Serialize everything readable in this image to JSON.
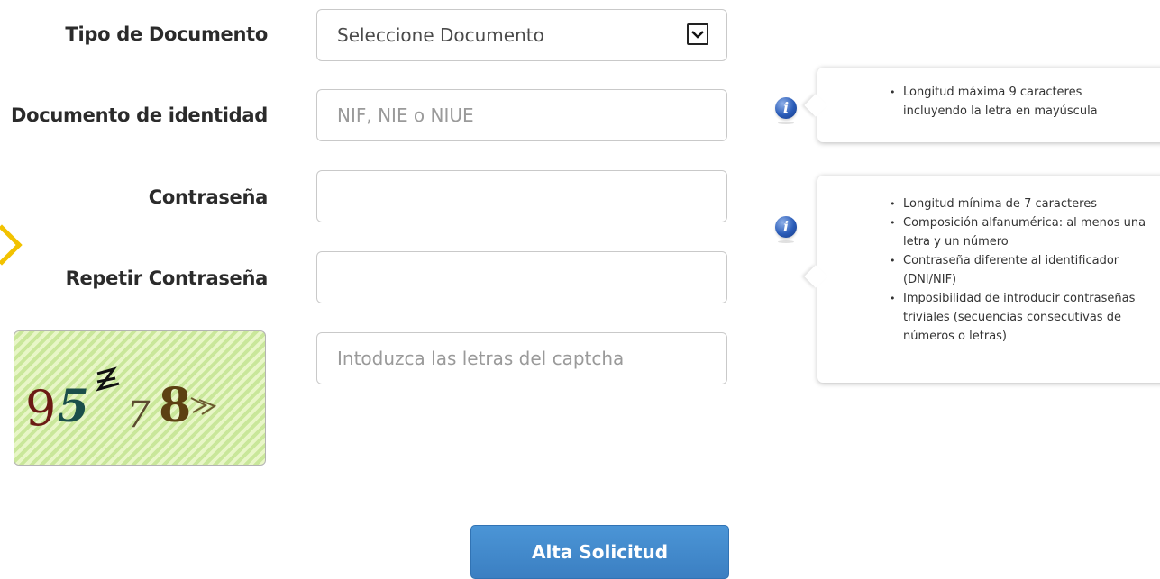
{
  "form": {
    "tipo_documento": {
      "label": "Tipo de Documento",
      "selected": "Seleccione Documento"
    },
    "documento_identidad": {
      "label": "Documento de identidad",
      "placeholder": "NIF, NIE o NIUE",
      "value": ""
    },
    "contrasena": {
      "label": "Contraseña",
      "value": ""
    },
    "repetir_contrasena": {
      "label": "Repetir Contraseña",
      "value": ""
    },
    "captcha": {
      "image_text": "95778",
      "placeholder": "Intoduzca las letras del captcha",
      "value": ""
    },
    "submit_label": "Alta Solicitud"
  },
  "tooltips": {
    "documento": {
      "items": [
        "Longitud máxima 9 caracteres incluyendo la letra en mayúscula"
      ]
    },
    "contrasena": {
      "items": [
        "Longitud mínima de 7 caracteres",
        "Composición alfanumérica: al menos una letra y un número",
        "Contraseña diferente al identificador (DNI/NIF)",
        "Imposibilidad de introducir contraseñas triviales (secuencias consecutivas de números o letras)"
      ]
    }
  },
  "icons": {
    "info": "info-icon",
    "dropdown": "chevron-down-icon",
    "side_marker": "chevron-right-icon"
  },
  "colors": {
    "submit_button": "#4289cc",
    "info_icon": "#2a5cb8",
    "side_marker": "#f2c200",
    "captcha_bg": "#e8f6c7"
  }
}
